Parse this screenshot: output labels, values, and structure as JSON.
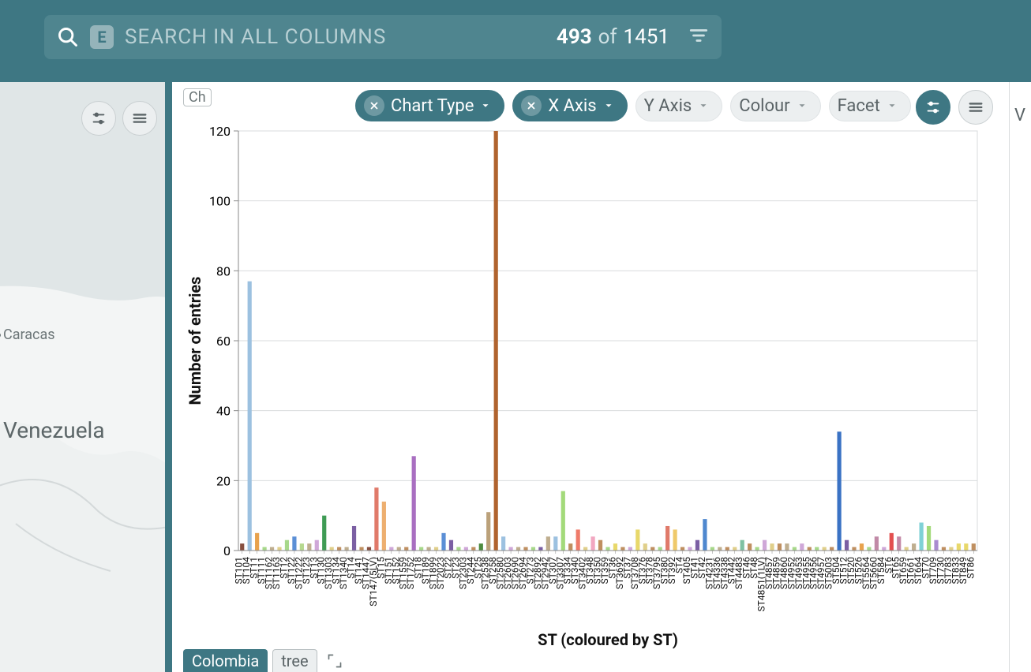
{
  "search": {
    "placeholder": "SEARCH IN ALL COLUMNS",
    "badge": "E",
    "shown": "493",
    "of_label": "of",
    "total": "1451"
  },
  "chips": {
    "chart_type": "Chart Type",
    "x_axis": "X Axis",
    "y_axis": "Y Axis",
    "colour": "Colour",
    "facet": "Facet"
  },
  "truncated_tag": "Ch",
  "map": {
    "city": "Caracas",
    "country": "Venezuela"
  },
  "bottom_tabs": {
    "active": "Colombia",
    "other": "tree"
  },
  "right_edge_letter": "V",
  "chart_data": {
    "type": "bar",
    "title": "",
    "ylabel": "Number of entries",
    "xlabel": "ST (coloured by ST)",
    "ylim": [
      0,
      120
    ],
    "yticks": [
      0,
      20,
      40,
      60,
      80,
      100,
      120
    ],
    "categories": [
      "ST101",
      "ST104",
      "ST11",
      "ST111",
      "ST1162",
      "ST1163",
      "ST12",
      "ST122",
      "ST1222",
      "ST123",
      "ST13",
      "ST130",
      "ST1303",
      "ST134",
      "ST1340",
      "ST14",
      "ST141",
      "ST1447",
      "ST147(5LV)",
      "ST15",
      "ST151",
      "ST152",
      "ST1559",
      "ST1752",
      "ST18",
      "ST189",
      "ST1899",
      "ST2023",
      "ST22",
      "ST23",
      "ST2303",
      "ST244",
      "ST25",
      "ST2538",
      "ST258",
      "ST2580",
      "ST2603",
      "ST2690",
      "ST2694",
      "ST273",
      "ST2892",
      "ST2942",
      "ST307",
      "ST3307",
      "ST334",
      "ST340",
      "ST3402",
      "ST348",
      "ST350",
      "ST359",
      "ST36",
      "ST3692",
      "ST37",
      "ST3708",
      "ST376",
      "ST378",
      "ST3795",
      "ST380",
      "ST392",
      "ST4",
      "ST405",
      "ST41",
      "ST42",
      "ST4231",
      "ST4336",
      "ST4338",
      "ST442",
      "ST4483",
      "ST46",
      "ST48",
      "ST4851(1LV)",
      "ST4857",
      "ST4859",
      "ST4860",
      "ST4952",
      "ST4953",
      "ST4955",
      "ST4956",
      "ST4957",
      "ST5003",
      "ST504",
      "ST512",
      "ST520",
      "ST526",
      "ST5564",
      "ST5660",
      "ST584",
      "ST6",
      "ST65",
      "ST659",
      "ST661",
      "ST664",
      "ST70",
      "ST709",
      "ST730",
      "ST783",
      "ST833",
      "ST849",
      "ST86"
    ],
    "values": [
      2,
      77,
      5,
      1,
      1,
      1,
      3,
      4,
      2,
      2,
      3,
      10,
      1,
      1,
      1,
      7,
      1,
      1,
      18,
      14,
      1,
      1,
      1,
      27,
      1,
      1,
      1,
      5,
      3,
      1,
      1,
      1,
      2,
      11,
      120,
      4,
      1,
      1,
      1,
      1,
      1,
      4,
      4,
      17,
      2,
      6,
      1,
      4,
      3,
      1,
      2,
      1,
      1,
      6,
      2,
      1,
      1,
      7,
      6,
      1,
      1,
      3,
      9,
      1,
      1,
      1,
      1,
      3,
      2,
      1,
      3,
      2,
      2,
      2,
      1,
      2,
      1,
      1,
      1,
      1,
      34,
      3,
      1,
      2,
      1,
      4,
      1,
      5,
      4,
      1,
      2,
      8,
      7,
      3,
      1,
      1,
      2,
      2,
      2
    ],
    "colors": [
      "#874f3f",
      "#9cc1e0",
      "#e8a24d",
      "#a7d88a",
      "#bfae8f",
      "#e0cf8a",
      "#a7d88a",
      "#5b8fd6",
      "#b6d98f",
      "#bfae8f",
      "#cfa7d8",
      "#3f9b54",
      "#e0cf8a",
      "#bf8f60",
      "#bfae8f",
      "#7b5fa3",
      "#bf8f60",
      "#874f3f",
      "#e07a6a",
      "#edaf70",
      "#cfa7d8",
      "#bfae8f",
      "#bf8f60",
      "#a96fc1",
      "#a7d88a",
      "#bfae8f",
      "#e0cf8a",
      "#5b8fd6",
      "#7b5fa3",
      "#a7d88a",
      "#cfa7d8",
      "#bf8f60",
      "#4d8b3f",
      "#bba17a",
      "#b0632e",
      "#9cc1e0",
      "#cfa7d8",
      "#bfae8f",
      "#bf8f60",
      "#a7d88a",
      "#7b5fa3",
      "#bfae8f",
      "#9cc1e0",
      "#a3da7a",
      "#bf8f60",
      "#ef7b6a",
      "#e0cf8a",
      "#f2a7c1",
      "#bf8f60",
      "#a7d88a",
      "#e8d86a",
      "#bf8f60",
      "#cfa7d8",
      "#e8d86a",
      "#e0cf8a",
      "#bf8f60",
      "#a7d88a",
      "#e07a6a",
      "#efc96a",
      "#bf8f60",
      "#cfa7d8",
      "#7b5fa3",
      "#4f88cf",
      "#a7d88a",
      "#bfae8f",
      "#bf8f60",
      "#e0cf8a",
      "#7fc1a3",
      "#bf8f60",
      "#a7d88a",
      "#cfa7d8",
      "#e0cf8a",
      "#bf8f60",
      "#bfae8f",
      "#a7d88a",
      "#cfa7d8",
      "#bf8f60",
      "#a7d88a",
      "#e0cf8a",
      "#bf8f60",
      "#3a72c4",
      "#7b5fa3",
      "#bf8f60",
      "#e8a24d",
      "#a7d88a",
      "#c18aa7",
      "#cfa7d8",
      "#e34f4f",
      "#c48aa7",
      "#e0cf8a",
      "#bfae8f",
      "#7fd1d6",
      "#a3da7a",
      "#a98bd0",
      "#bf8f60",
      "#e0cf8a",
      "#e8d86a",
      "#e8d86a",
      "#bf8f60"
    ]
  }
}
